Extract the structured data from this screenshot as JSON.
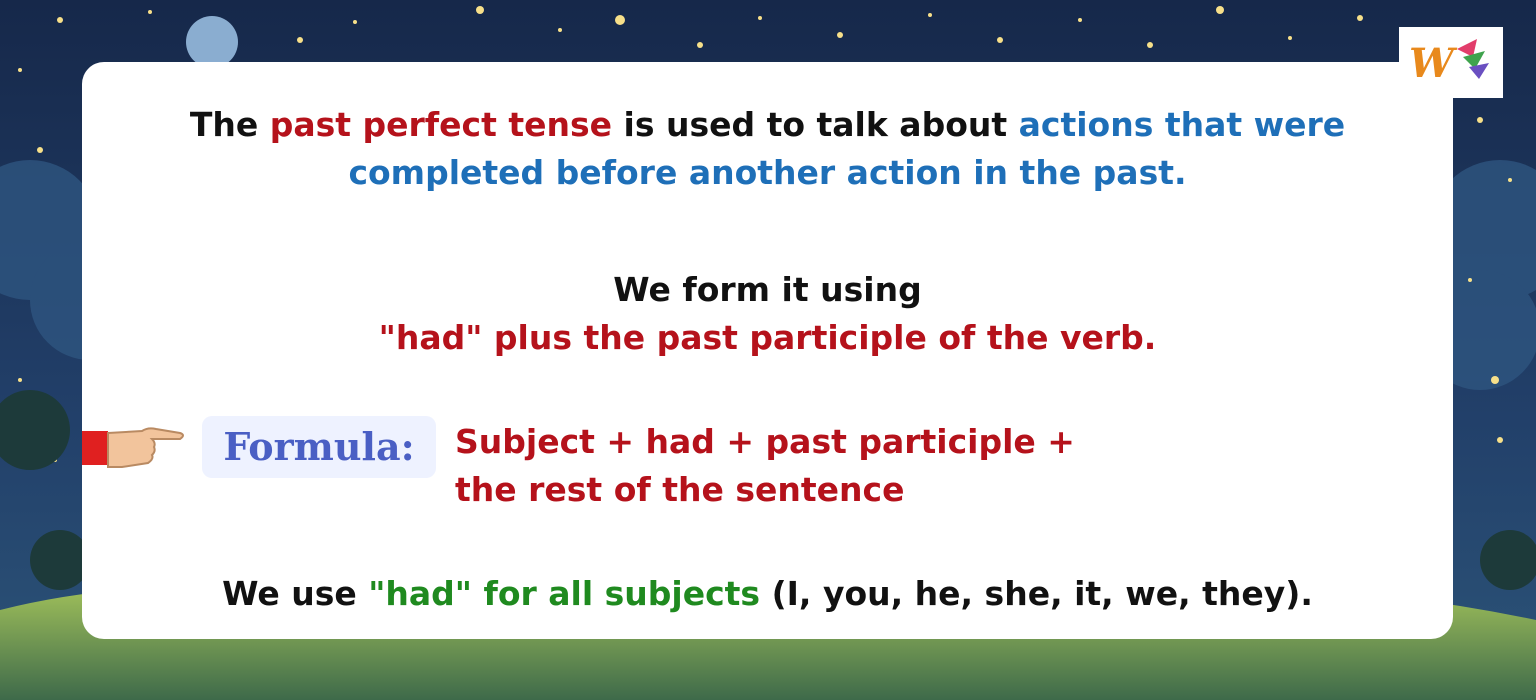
{
  "sentence1": {
    "part1": "The ",
    "part2": "past perfect tense",
    "part3": " is used to talk about ",
    "part4": "actions that were",
    "part5": "completed before another action in the past."
  },
  "sentence2": {
    "line1": "We form it using",
    "line2": "\"had\" plus the past participle of the verb."
  },
  "formula": {
    "badge": "Formula:",
    "line1": "Subject + had + past participle +",
    "line2": "the rest of the sentence"
  },
  "sentence3": {
    "part1": "We use ",
    "part2": "\"had\" for all subjects",
    "part3": " (I, you, he, she, it, we, they)."
  },
  "colors": {
    "red": "#b5121b",
    "blue": "#1e6fb8",
    "green": "#1f8a1f",
    "badge_text": "#4a5fc4",
    "sky": "#1a2c4e"
  },
  "icons": [
    "pointing-hand-icon",
    "brand-logo-icon",
    "star-icon",
    "moon-icon"
  ]
}
